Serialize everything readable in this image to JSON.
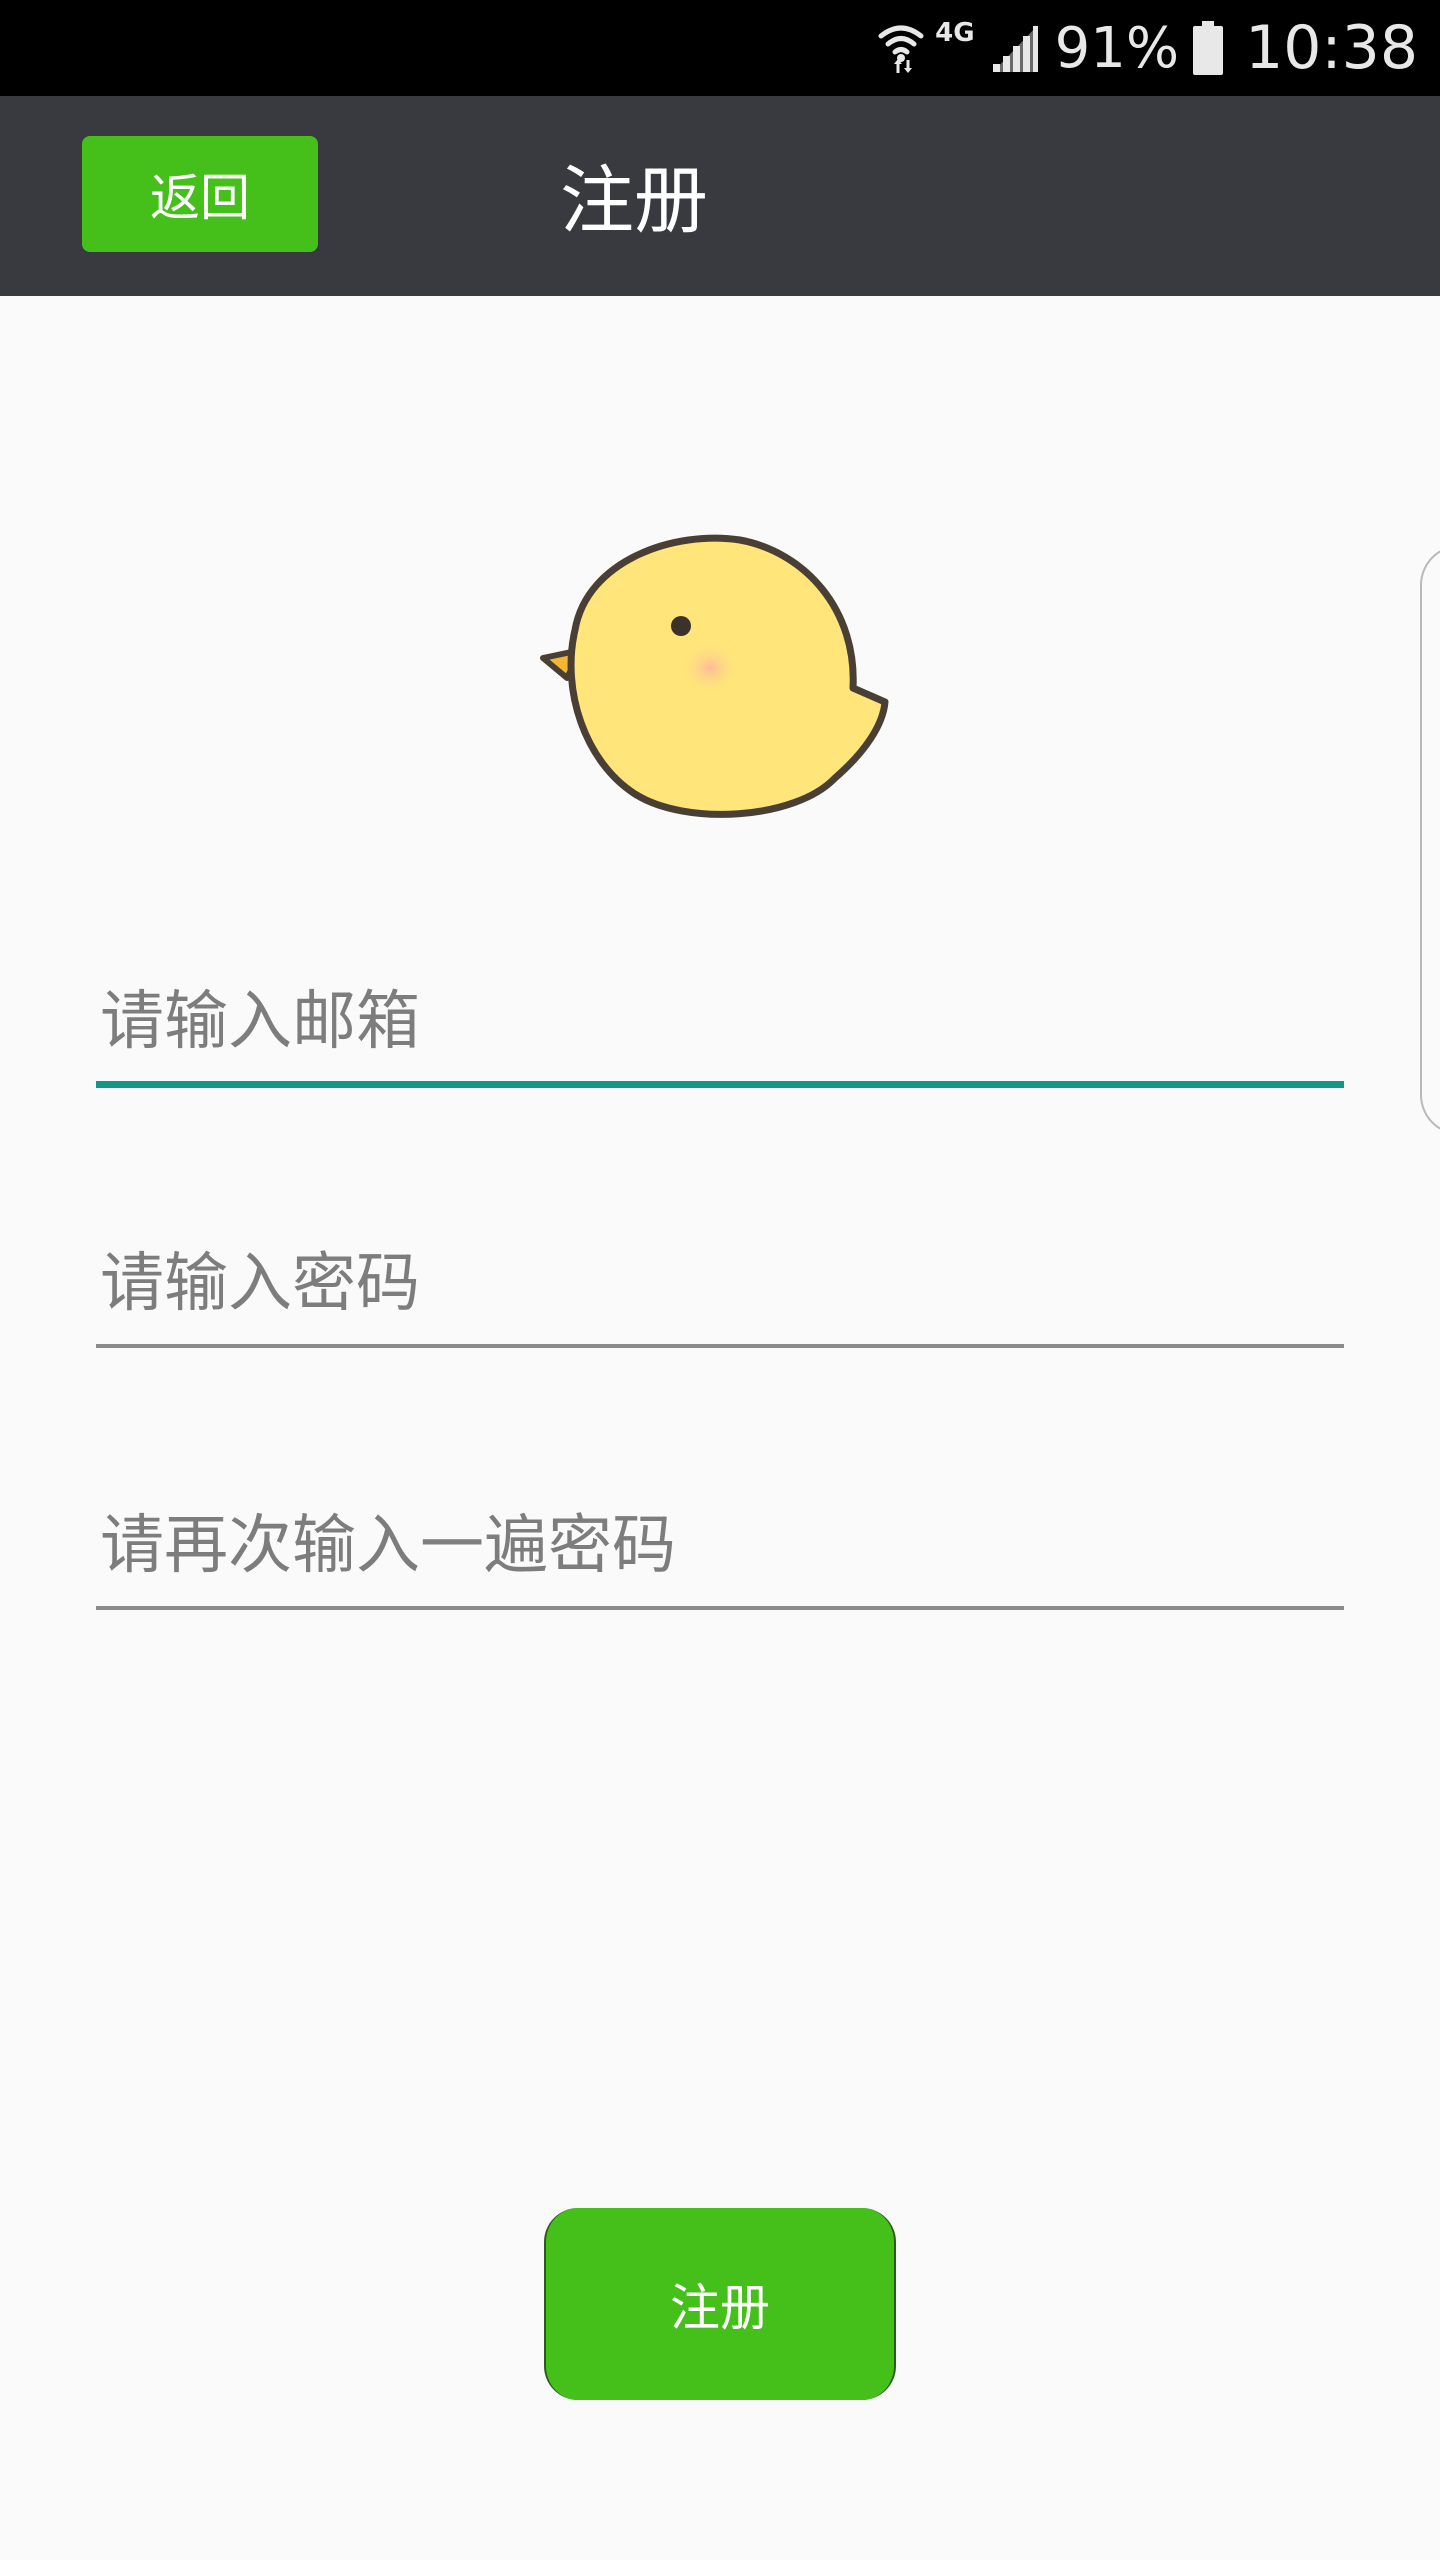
{
  "status_bar": {
    "network_type": "4G",
    "battery_percent": "91%",
    "time": "10:38",
    "icons": [
      "wifi-icon",
      "signal-icon",
      "battery-icon"
    ]
  },
  "app_bar": {
    "back_label": "返回",
    "title": "注册"
  },
  "form": {
    "email": {
      "placeholder": "请输入邮箱",
      "value": "",
      "focused": true
    },
    "password": {
      "placeholder": "请输入密码",
      "value": ""
    },
    "confirm_password": {
      "placeholder": "请再次输入一遍密码",
      "value": ""
    },
    "register_label": "注册"
  },
  "mascot_icon": "yellow-chick-icon",
  "colors": {
    "accent_green": "#45c01a",
    "app_bar_bg": "#393a3f",
    "focus_underline": "#129688",
    "page_bg": "#fafafa"
  }
}
